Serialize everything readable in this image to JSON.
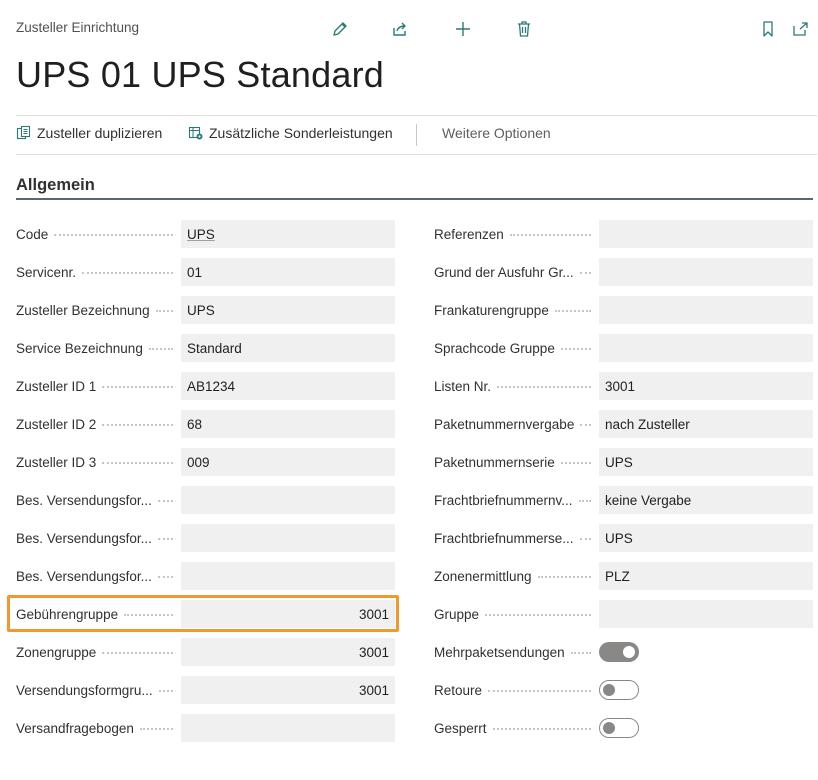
{
  "header": {
    "breadcrumb": "Zusteller Einrichtung",
    "title": "UPS 01 UPS Standard",
    "icons": [
      "edit-icon",
      "share-icon",
      "add-icon",
      "delete-icon",
      "bookmark-icon",
      "open-new-window-icon"
    ]
  },
  "actionbar": {
    "duplicate_label": "Zusteller duplizieren",
    "extra_services_label": "Zusätzliche Sonderleistungen",
    "more_label": "Weitere Optionen"
  },
  "section": {
    "title": "Allgemein"
  },
  "left_fields": [
    {
      "label": "Code",
      "value": "UPS"
    },
    {
      "label": "Servicenr.",
      "value": "01"
    },
    {
      "label": "Zusteller Bezeichnung",
      "value": "UPS"
    },
    {
      "label": "Service Bezeichnung",
      "value": "Standard"
    },
    {
      "label": "Zusteller ID 1",
      "value": "AB1234"
    },
    {
      "label": "Zusteller ID 2",
      "value": "68"
    },
    {
      "label": "Zusteller ID 3",
      "value": "009"
    },
    {
      "label": "Bes. Versendungsfor...",
      "value": ""
    },
    {
      "label": "Bes. Versendungsfor...",
      "value": ""
    },
    {
      "label": "Bes. Versendungsfor...",
      "value": ""
    },
    {
      "label": "Gebührengruppe",
      "value": "3001"
    },
    {
      "label": "Zonengruppe",
      "value": "3001"
    },
    {
      "label": "Versendungsformgru...",
      "value": "3001"
    },
    {
      "label": "Versandfragebogen",
      "value": ""
    }
  ],
  "right_fields": [
    {
      "label": "Referenzen",
      "value": ""
    },
    {
      "label": "Grund der Ausfuhr Gr...",
      "value": ""
    },
    {
      "label": "Frankaturengruppe",
      "value": ""
    },
    {
      "label": "Sprachcode Gruppe",
      "value": ""
    },
    {
      "label": "Listen Nr.",
      "value": "3001"
    },
    {
      "label": "Paketnummernvergabe",
      "value": "nach Zusteller"
    },
    {
      "label": "Paketnummernserie",
      "value": "UPS"
    },
    {
      "label": "Frachtbriefnummernv...",
      "value": "keine Vergabe"
    },
    {
      "label": "Frachtbriefnummerse...",
      "value": "UPS"
    },
    {
      "label": "Zonenermittlung",
      "value": "PLZ"
    },
    {
      "label": "Gruppe",
      "value": ""
    },
    {
      "label": "Mehrpaketsendungen",
      "toggle": true
    },
    {
      "label": "Retoure",
      "toggle": false
    },
    {
      "label": "Gesperrt",
      "toggle": false
    }
  ],
  "highlight_color": "#f3982f"
}
